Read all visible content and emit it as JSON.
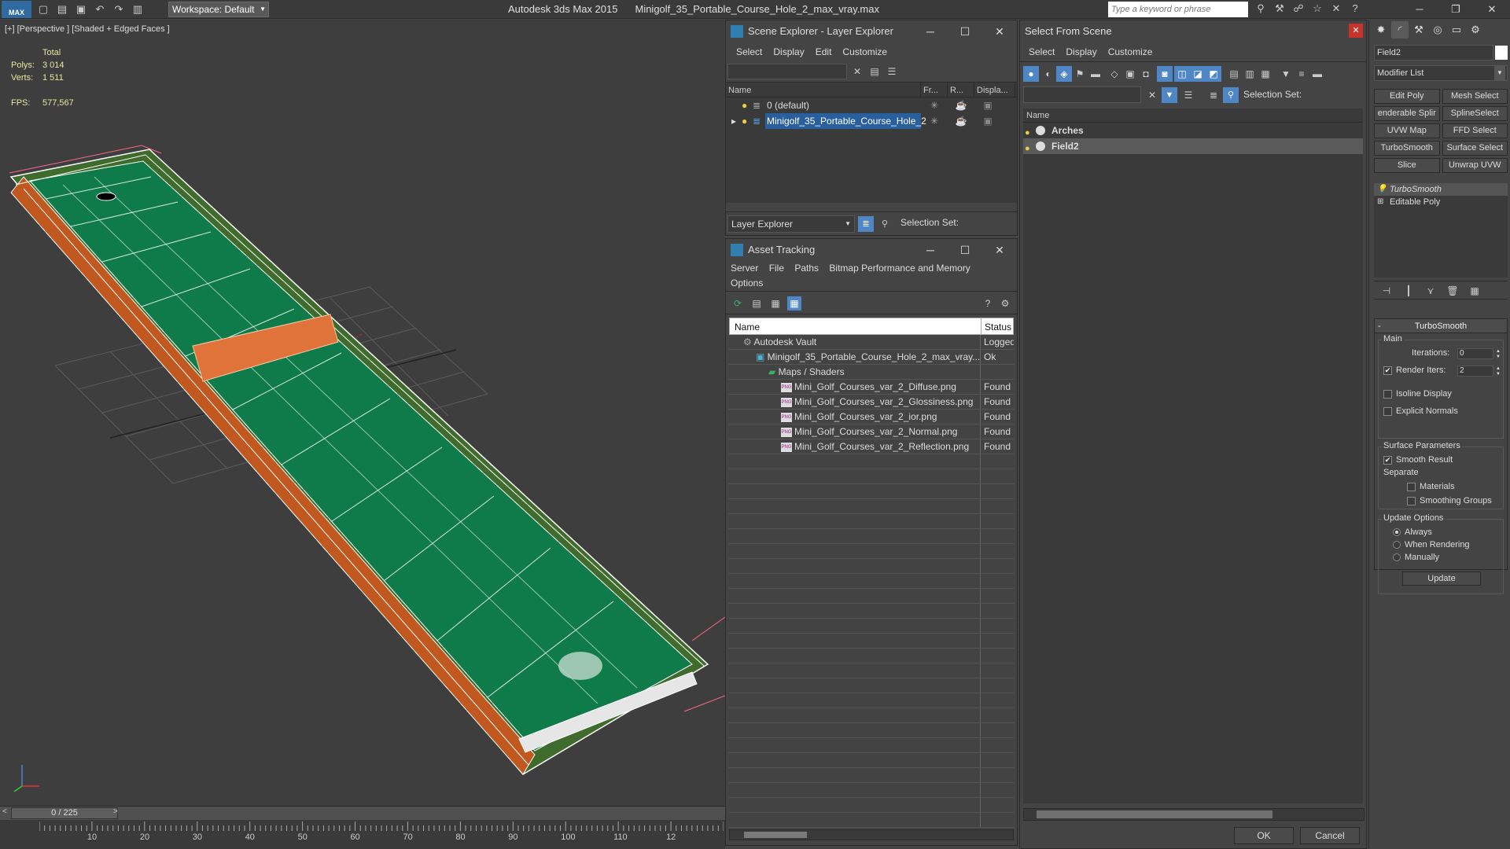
{
  "app": {
    "logo": "MAX",
    "title_app": "Autodesk 3ds Max  2015",
    "title_file": "Minigolf_35_Portable_Course_Hole_2_max_vray.max",
    "workspace_label": "Workspace: Default",
    "search_placeholder": "Type a keyword or phrase"
  },
  "viewport": {
    "label": "[+] [Perspective ] [Shaded + Edged Faces ]",
    "stats_header": "Total",
    "polys_label": "Polys:",
    "polys_value": "3 014",
    "verts_label": "Verts:",
    "verts_value": "1 511",
    "fps_label": "FPS:",
    "fps_value": "577,567",
    "time_slider": "0 / 225",
    "ruler_ticks": [
      "10",
      "20",
      "30",
      "40",
      "50",
      "60",
      "70",
      "80",
      "90",
      "100",
      "110",
      "12"
    ]
  },
  "scene_explorer": {
    "title": "Scene Explorer - Layer Explorer",
    "menu": [
      "Select",
      "Display",
      "Edit",
      "Customize"
    ],
    "columns": [
      "Name",
      "Fr...",
      "R...",
      "Displa..."
    ],
    "rows": [
      {
        "name": "0 (default)",
        "selected": false
      },
      {
        "name": "Minigolf_35_Portable_Course_Hole_2",
        "selected": true
      }
    ],
    "footer_dropdown": "Layer Explorer",
    "footer_selection_set": "Selection Set:"
  },
  "asset_tracking": {
    "title": "Asset Tracking",
    "menu": [
      "Server",
      "File",
      "Paths",
      "Bitmap Performance and Memory",
      "Options"
    ],
    "columns": {
      "name": "Name",
      "status": "Status"
    },
    "rows": [
      {
        "name": "Autodesk Vault",
        "status": "Logged",
        "indent": 1,
        "icon": "vault"
      },
      {
        "name": "Minigolf_35_Portable_Course_Hole_2_max_vray...",
        "status": "Ok",
        "indent": 2,
        "icon": "max"
      },
      {
        "name": "Maps / Shaders",
        "status": "",
        "indent": 3,
        "icon": "folder"
      },
      {
        "name": "Mini_Golf_Courses_var_2_Diffuse.png",
        "status": "Found",
        "indent": 4,
        "icon": "png"
      },
      {
        "name": "Mini_Golf_Courses_var_2_Glossiness.png",
        "status": "Found",
        "indent": 4,
        "icon": "png"
      },
      {
        "name": "Mini_Golf_Courses_var_2_ior.png",
        "status": "Found",
        "indent": 4,
        "icon": "png"
      },
      {
        "name": "Mini_Golf_Courses_var_2_Normal.png",
        "status": "Found",
        "indent": 4,
        "icon": "png"
      },
      {
        "name": "Mini_Golf_Courses_var_2_Reflection.png",
        "status": "Found",
        "indent": 4,
        "icon": "png"
      }
    ],
    "png_icon_text": "PNG"
  },
  "select_from_scene": {
    "title": "Select From Scene",
    "menu": [
      "Select",
      "Display",
      "Customize"
    ],
    "selection_set_label": "Selection Set:",
    "column_name": "Name",
    "rows": [
      {
        "name": "Arches",
        "selected": false
      },
      {
        "name": "Field2",
        "selected": true
      }
    ],
    "ok_label": "OK",
    "cancel_label": "Cancel"
  },
  "command_panel": {
    "object_name": "Field2",
    "modifier_list": "Modifier List",
    "buttons": [
      "Edit Poly",
      "Mesh Select",
      "enderable Splir",
      "SplineSelect",
      "UVW Map",
      "FFD Select",
      "TurboSmooth",
      "Surface Select",
      "Slice",
      "Unwrap UVW"
    ],
    "stack": [
      {
        "name": "TurboSmooth",
        "selected": true,
        "italic": true
      },
      {
        "name": "Editable Poly",
        "selected": false,
        "italic": false
      }
    ],
    "rollout_title": "TurboSmooth",
    "main_label": "Main",
    "iterations_label": "Iterations:",
    "iterations_value": "0",
    "render_iters_label": "Render Iters:",
    "render_iters_value": "2",
    "render_iters_checked": true,
    "isoline_label": "Isoline Display",
    "explicit_normals_label": "Explicit Normals",
    "surface_params_label": "Surface Parameters",
    "smooth_result_label": "Smooth Result",
    "smooth_result_checked": true,
    "separate_label": "Separate",
    "materials_label": "Materials",
    "smoothing_groups_label": "Smoothing Groups",
    "update_options_label": "Update Options",
    "always_label": "Always",
    "when_rendering_label": "When Rendering",
    "manually_label": "Manually",
    "update_button": "Update"
  },
  "colors": {
    "accent_blue": "#2a5f9e",
    "field_green": "#0f7a4a",
    "wireframe_white": "#ffffff",
    "arch_orange": "#e0733a",
    "close_red": "#c8342c"
  }
}
